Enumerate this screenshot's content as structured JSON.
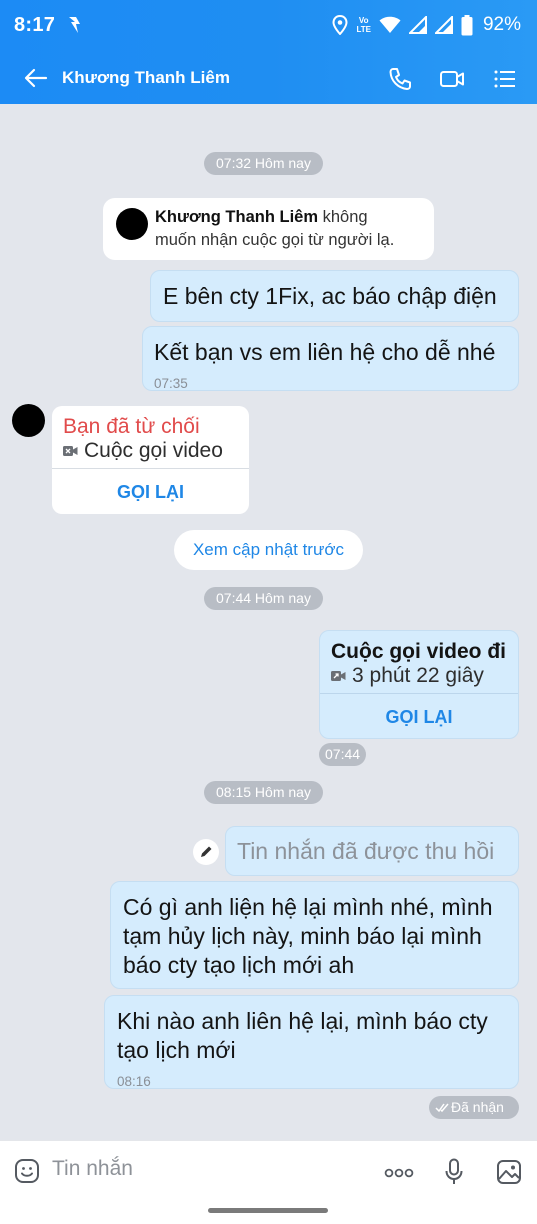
{
  "status_bar": {
    "time": "8:17",
    "volte_top": "Vo",
    "volte_mid": "LTE",
    "battery_pct": "92%"
  },
  "header": {
    "title": "Khương Thanh Liêm",
    "icons": [
      "back-arrow-icon",
      "phone-icon",
      "video-icon",
      "menu-icon"
    ]
  },
  "messages": {
    "ts1": "07:32 Hôm nay",
    "system_name": "Khương Thanh Liêm",
    "system_text": "không",
    "system_text_2": "muốn nhận cuộc gọi từ người lạ.",
    "out1": "E bên cty 1Fix, ac báo chập điện",
    "out2": "Kết bạn vs em liên hệ cho dễ nhé",
    "out2_time": "07:35",
    "call_in_title": "Bạn đã từ chối",
    "call_in_sub": "Cuộc gọi video",
    "call_in_btn": "GỌI LẠI",
    "see_more": "Xem cập nhật trước",
    "ts2": "07:44 Hôm nay",
    "call_out_title": "Cuộc gọi video đi",
    "call_out_sub": "3 phút 22 giây",
    "call_out_btn": "GỌI LẠI",
    "call_out_time": "07:44",
    "ts3": "08:15 Hôm nay",
    "recalled": "Tin nhắn đã được thu hồi",
    "out3_line1": "Có gì anh liện hệ lại mình nhé, mình",
    "out3_line2": "tạm hủy lịch này, minh báo lại mình",
    "out3_line3": "báo cty tạo lịch mới ah",
    "out4_line1": "Khi nào anh liên hệ lại, mình báo cty",
    "out4_line2": "tạo lịch mới",
    "out4_time": "08:16",
    "received": "Đã nhận"
  },
  "input": {
    "placeholder": "Tin nhắn",
    "more_label": "ooo"
  },
  "colors": {
    "header": "#1f8ef2",
    "chat_bg": "#e3e6ec",
    "out_bubble": "#d5ecfd",
    "declined_red": "#e14b4b",
    "link_blue": "#1f87e6"
  }
}
